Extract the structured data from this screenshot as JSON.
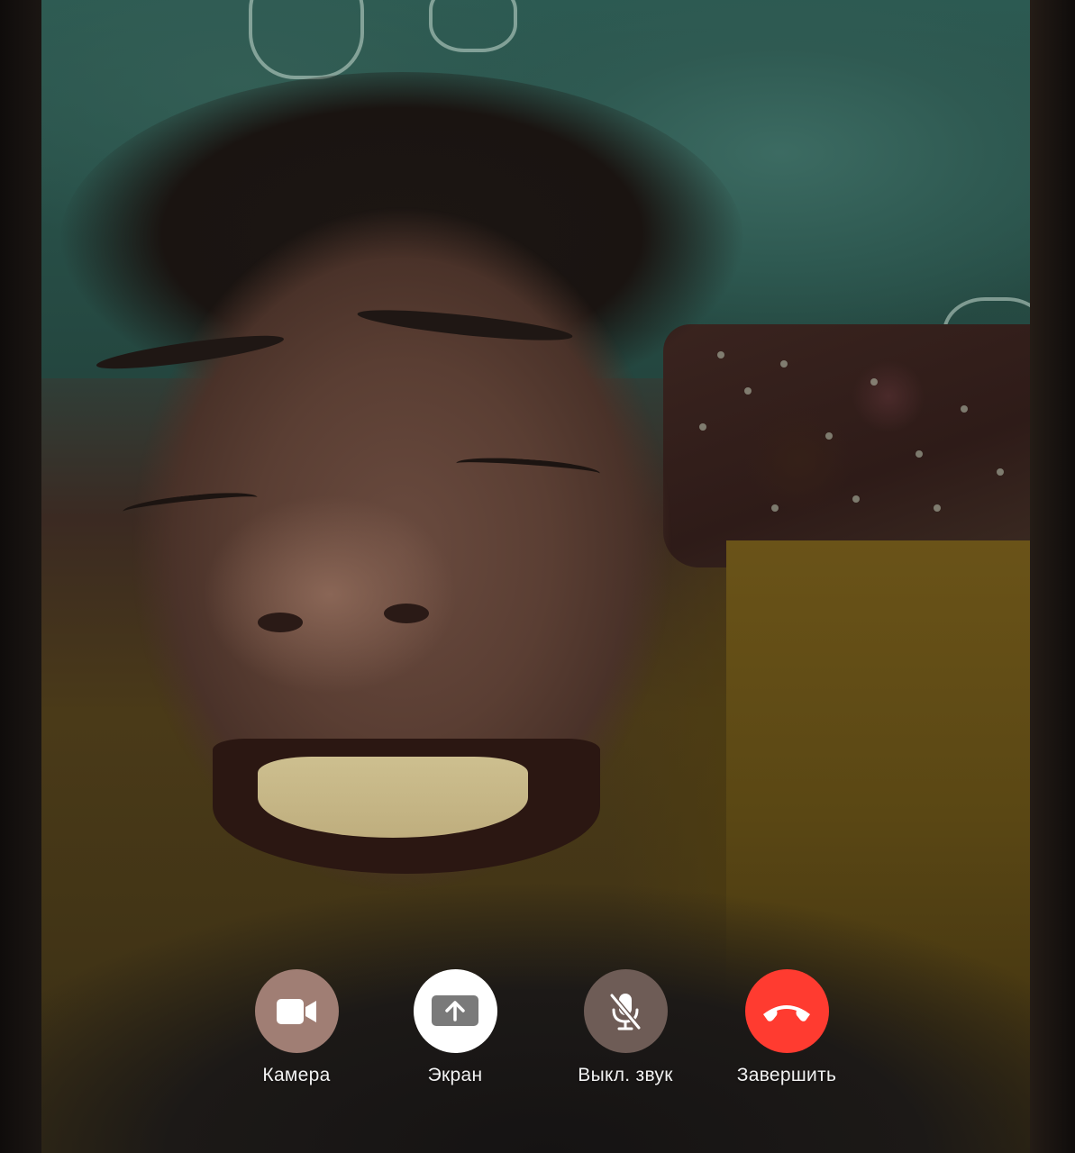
{
  "video_call": {
    "remote_video": "remote-participant-video"
  },
  "controls": {
    "camera": {
      "label": "Камера",
      "icon": "video-camera-icon",
      "bg": "#a07e74"
    },
    "screen": {
      "label": "Экран",
      "icon": "screen-share-icon",
      "bg": "#ffffff"
    },
    "mute": {
      "label": "Выкл. звук",
      "icon": "mic-off-icon",
      "bg": "#6e5c56"
    },
    "end": {
      "label": "Завершить",
      "icon": "end-call-icon",
      "bg": "#ff3b30"
    }
  }
}
